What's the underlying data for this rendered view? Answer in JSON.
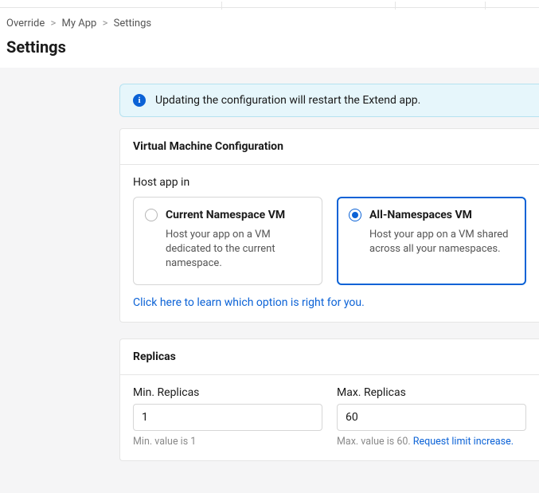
{
  "breadcrumb": {
    "items": [
      "Override",
      "My App",
      "Settings"
    ]
  },
  "page_title": "Settings",
  "info_banner": {
    "text": "Updating the configuration will restart the Extend app."
  },
  "vm_config": {
    "title": "Virtual Machine Configuration",
    "host_label": "Host app in",
    "options": [
      {
        "title": "Current Namespace VM",
        "desc": "Host your app on a VM dedicated to the current namespace.",
        "selected": false
      },
      {
        "title": "All-Namespaces VM",
        "desc": "Host your app on a VM shared across all your namespaces.",
        "selected": true
      }
    ],
    "learn_link": "Click here to learn which option is right for you."
  },
  "replicas": {
    "title": "Replicas",
    "min": {
      "label": "Min. Replicas",
      "value": "1",
      "helper": "Min. value is 1"
    },
    "max": {
      "label": "Max. Replicas",
      "value": "60",
      "helper_prefix": "Max. value is 60. ",
      "helper_link": "Request limit increase."
    }
  }
}
